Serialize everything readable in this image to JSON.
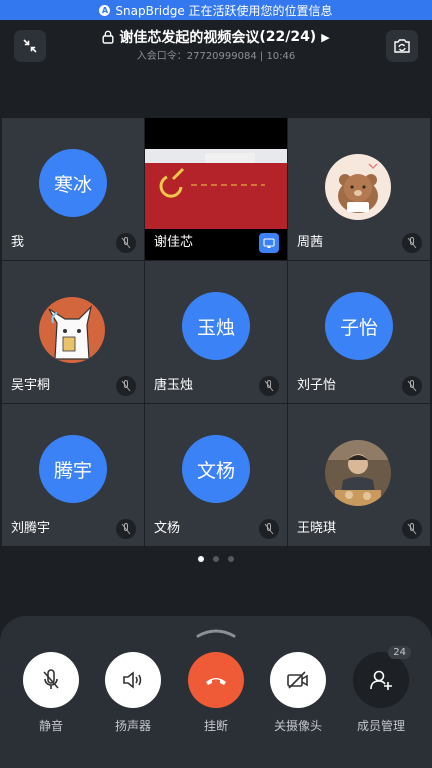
{
  "banner": {
    "text": "SnapBridge 正在活跃使用您的位置信息",
    "logo_letter": "A"
  },
  "header": {
    "title": "谢佳芯发起的视频会议",
    "count": "(22/24)",
    "subtitle": "入会口令：27720999084 | 10:46",
    "left_icon": "shrink-arrows-icon",
    "right_icon": "switch-camera-icon"
  },
  "participants": [
    {
      "name": "我",
      "avatar_text": "寒冰",
      "type": "initials",
      "muted": true
    },
    {
      "name": "谢佳芯",
      "type": "video",
      "sharing": true
    },
    {
      "name": "周茜",
      "type": "photo",
      "photo": "bear-illustration",
      "muted": true
    },
    {
      "name": "吴宇桐",
      "type": "photo",
      "photo": "cat-illustration",
      "muted": true
    },
    {
      "name": "唐玉烛",
      "avatar_text": "玉烛",
      "type": "initials",
      "muted": true
    },
    {
      "name": "刘子怡",
      "avatar_text": "子怡",
      "type": "initials",
      "muted": true
    },
    {
      "name": "刘腾宇",
      "avatar_text": "腾宇",
      "type": "initials",
      "muted": true
    },
    {
      "name": "文杨",
      "avatar_text": "文杨",
      "type": "initials",
      "muted": true
    },
    {
      "name": "王晓琪",
      "type": "photo",
      "photo": "person-photo",
      "muted": true
    }
  ],
  "pagination": {
    "pages": 3,
    "current": 1
  },
  "controls": {
    "mute": "静音",
    "speaker": "扬声器",
    "hangup": "挂断",
    "camera_off": "关摄像头",
    "members": "成员管理",
    "members_count": "24"
  },
  "colors": {
    "accent": "#3b82f6",
    "banner": "#3478f0",
    "hangup": "#ef5a37",
    "background": "#1c1f24",
    "tile": "#33373e"
  }
}
